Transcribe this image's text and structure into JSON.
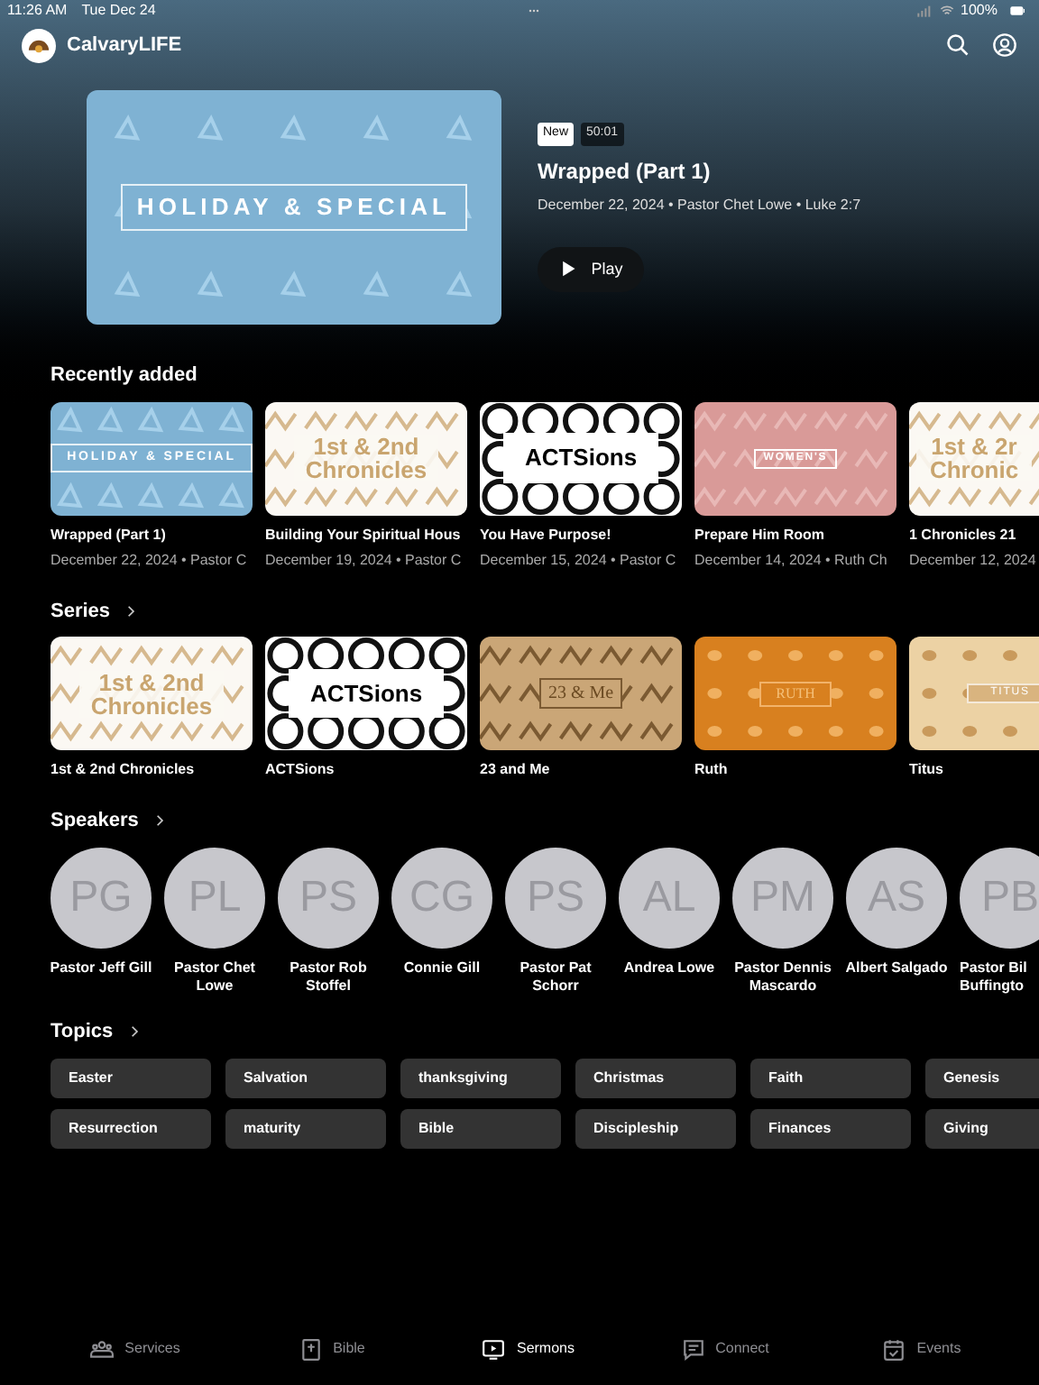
{
  "status_bar": {
    "time": "11:26 AM",
    "date": "Tue Dec 24",
    "battery": "100%"
  },
  "header": {
    "app_name": "CalvaryLIFE"
  },
  "hero": {
    "art": {
      "kind": "holiday",
      "text": "HOLIDAY & SPECIAL"
    },
    "badge": "New",
    "duration": "50:01",
    "title": "Wrapped (Part 1)",
    "meta": "December 22, 2024 • Pastor Chet Lowe • Luke 2:7",
    "play_label": "Play"
  },
  "recently_added": {
    "heading": "Recently added",
    "items": [
      {
        "art": {
          "kind": "holiday",
          "text": "HOLIDAY & SPECIAL"
        },
        "title": "Wrapped (Part 1)",
        "meta": "December 22, 2024 • Pastor C"
      },
      {
        "art": {
          "kind": "chronicles",
          "text": "1st & 2nd Chronicles"
        },
        "title": "Building Your Spiritual Hous",
        "meta": "December 19, 2024 • Pastor C"
      },
      {
        "art": {
          "kind": "actsions",
          "text": "ACTSions"
        },
        "title": "You Have Purpose!",
        "meta": "December 15, 2024 • Pastor C"
      },
      {
        "art": {
          "kind": "womens",
          "text": "WOMEN'S"
        },
        "title": "Prepare Him Room",
        "meta": "December 14, 2024 • Ruth Ch"
      },
      {
        "art": {
          "kind": "chronicles",
          "text": "1st & 2r Chronic"
        },
        "title": "1 Chronicles 21",
        "meta": "December 12, 2024"
      }
    ]
  },
  "series": {
    "heading": "Series",
    "items": [
      {
        "art": {
          "kind": "chronicles",
          "text": "1st & 2nd Chronicles"
        },
        "title": "1st & 2nd Chronicles"
      },
      {
        "art": {
          "kind": "actsions",
          "text": "ACTSions"
        },
        "title": "ACTSions"
      },
      {
        "art": {
          "kind": "tan",
          "text": "23 & Me"
        },
        "title": "23 and Me"
      },
      {
        "art": {
          "kind": "ruth",
          "text": "RUTH"
        },
        "title": "Ruth"
      },
      {
        "art": {
          "kind": "titus",
          "text": "TITUS"
        },
        "title": "Titus"
      }
    ]
  },
  "speakers": {
    "heading": "Speakers",
    "items": [
      {
        "initials": "PG",
        "name": "Pastor Jeff Gill"
      },
      {
        "initials": "PL",
        "name": "Pastor Chet Lowe"
      },
      {
        "initials": "PS",
        "name": "Pastor Rob Stoffel"
      },
      {
        "initials": "CG",
        "name": "Connie Gill"
      },
      {
        "initials": "PS",
        "name": "Pastor Pat Schorr"
      },
      {
        "initials": "AL",
        "name": "Andrea Lowe"
      },
      {
        "initials": "PM",
        "name": "Pastor Dennis Mascardo"
      },
      {
        "initials": "AS",
        "name": "Albert Salgado"
      },
      {
        "initials": "PB",
        "name": "Pastor Bil Buffingto"
      }
    ]
  },
  "topics": {
    "heading": "Topics",
    "rows": [
      [
        "Easter",
        "Salvation",
        "thanksgiving",
        "Christmas",
        "Faith",
        "Genesis"
      ],
      [
        "Resurrection",
        "maturity",
        "Bible",
        "Discipleship",
        "Finances",
        "Giving"
      ]
    ]
  },
  "tab_bar": [
    {
      "label": "Services",
      "selected": false
    },
    {
      "label": "Bible",
      "selected": false
    },
    {
      "label": "Sermons",
      "selected": true
    },
    {
      "label": "Connect",
      "selected": false
    },
    {
      "label": "Events",
      "selected": false
    }
  ]
}
